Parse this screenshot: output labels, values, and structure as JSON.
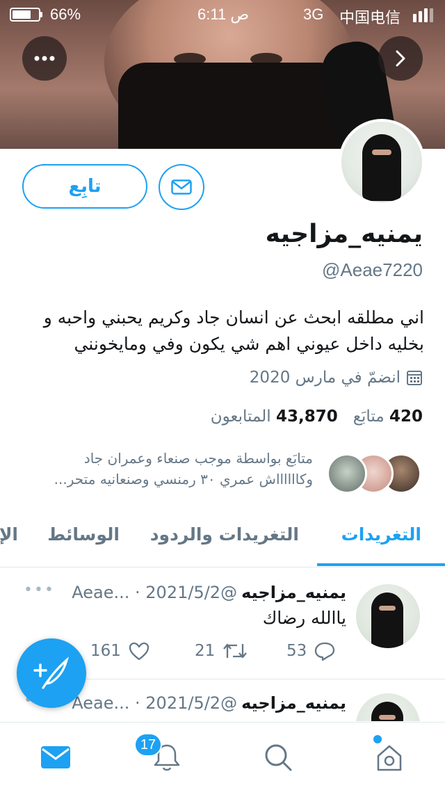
{
  "status_bar": {
    "battery": "66%",
    "time": "6:11 ص",
    "network": "3G",
    "carrier": "中国电信"
  },
  "profile": {
    "follow_label": "تابِع",
    "name": "يمنيه_مزاجيه",
    "handle": "@Aeae7220",
    "bio_line1": "اني مطلقه ابحث عن انسان جاد وكريم يحبني واحبه و",
    "bio_line2": "بخليه داخل عيوني اهم شي يكون وفي ومايخونني",
    "joined": "انضمّ في مارس 2020",
    "following_count": "420",
    "following_label": "متابَع",
    "followers_count": "43,870",
    "followers_label": "المتابعون",
    "followed_by_line1": "متابَع بواسطة موجب صنعاء وعمران جاد",
    "followed_by_line2": "وكااااااش عمري ٣٠ رمنسي وصنعانيه متحر..."
  },
  "tabs": [
    {
      "label": "التغريدات",
      "active": true
    },
    {
      "label": "التغريدات والردود",
      "active": false
    },
    {
      "label": "الوسائط",
      "active": false
    },
    {
      "label": "الإ",
      "active": false
    }
  ],
  "tweets": [
    {
      "name": "يمنيه_مزاجيه",
      "meta": "@Aeae... · 2021/5/2",
      "text": "ياالله رضاك",
      "replies": "53",
      "retweets": "21",
      "likes": "161"
    },
    {
      "name": "يمنيه_مزاجيه",
      "meta": "@Aeae... · 2021/5/2"
    }
  ],
  "bottom_nav": {
    "notifications_badge": "17"
  },
  "colors": {
    "accent": "#1da1f2",
    "text": "#14171a",
    "muted": "#657786"
  }
}
